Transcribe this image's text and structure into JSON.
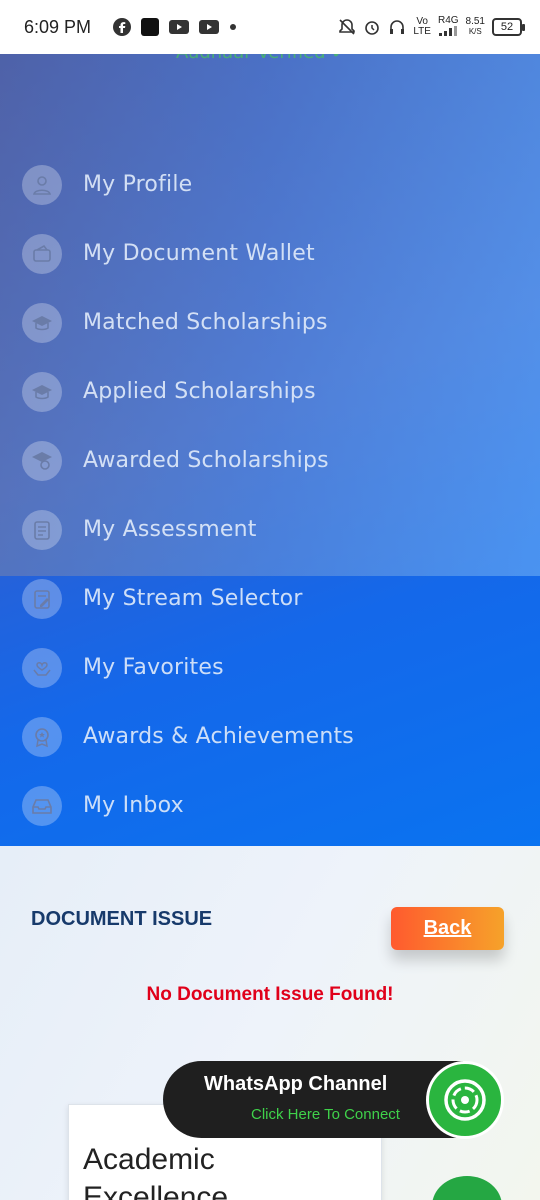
{
  "status_bar": {
    "time": "6:09 PM",
    "network_top": "Vo",
    "network_bottom": "LTE",
    "signal_label": "R4G",
    "speed_value": "8.51",
    "speed_unit": "K/S",
    "battery": "52"
  },
  "menu": {
    "top_label": "Aadhaar Verified",
    "items": [
      {
        "label": "My Profile",
        "icon": "user-icon"
      },
      {
        "label": "My Document Wallet",
        "icon": "wallet-icon"
      },
      {
        "label": "Matched Scholarships",
        "icon": "graduation-cap-icon"
      },
      {
        "label": "Applied Scholarships",
        "icon": "graduation-cap-icon"
      },
      {
        "label": "Awarded Scholarships",
        "icon": "award-cap-icon"
      },
      {
        "label": "My Assessment",
        "icon": "clipboard-icon"
      },
      {
        "label": "My Stream Selector",
        "icon": "clipboard-edit-icon"
      },
      {
        "label": "My Favorites",
        "icon": "hands-heart-icon"
      },
      {
        "label": "Awards & Achievements",
        "icon": "medal-icon"
      },
      {
        "label": "My Inbox",
        "icon": "inbox-icon"
      }
    ]
  },
  "content": {
    "title": "DOCUMENT ISSUE",
    "back_label": "Back",
    "empty_message": "No Document Issue Found!",
    "card_title_line1": "Academic",
    "card_title_line2": "Excellence Scholarship"
  },
  "whatsapp": {
    "title": "WhatsApp Channel",
    "subtitle": "Click Here To Connect"
  },
  "colors": {
    "menu_gradient_start": "#1c3aa6",
    "menu_gradient_end": "#0a73f0",
    "title_color": "#173a6b",
    "back_start": "#ff5a2e",
    "back_end": "#f6a22a",
    "error_red": "#e0001a",
    "whatsapp_green": "#2ab53f"
  }
}
